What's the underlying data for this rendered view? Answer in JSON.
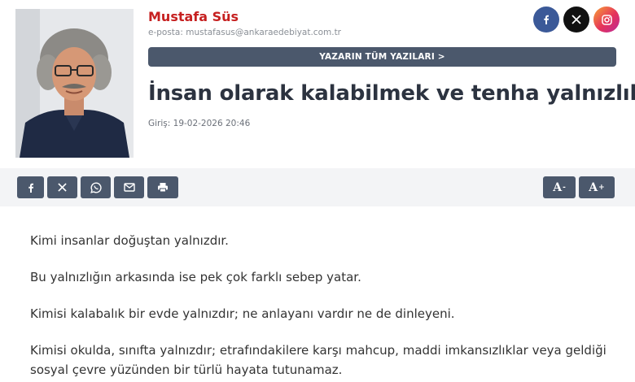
{
  "author": {
    "name": "Mustafa Süs",
    "email": "e-posta: mustafasus@ankaraedebiyat.com.tr",
    "all_posts_label": "YAZARIN TÜM YAZILARI >"
  },
  "social": [
    "facebook-icon",
    "x-icon",
    "instagram-icon"
  ],
  "article": {
    "title": "İnsan olarak kalabilmek ve tenha yalnızlık",
    "posted": "Giriş: 19-02-2026 20:46",
    "paragraphs": [
      "Kimi insanlar doğuştan yalnızdır.",
      "Bu yalnızlığın arkasında ise pek çok farklı sebep yatar.",
      "Kimisi kalabalık bir evde yalnızdır; ne anlayanı vardır ne de dinleyeni.",
      "Kimisi okulda, sınıfta yalnızdır; etrafındakilere karşı mahcup, maddi imkansızlıklar veya geldiği sosyal çevre yüzünden bir türlü hayata tutunamaz."
    ]
  },
  "toolbar": {
    "share_icons": [
      "facebook-icon",
      "x-icon",
      "whatsapp-icon",
      "mail-icon",
      "print-icon"
    ],
    "font_decrease": "A",
    "font_decrease_sign": "-",
    "font_increase": "A",
    "font_increase_sign": "+"
  },
  "colors": {
    "accent_red": "#c62020",
    "button_slate": "#4b586c",
    "facebook": "#3b5998"
  }
}
